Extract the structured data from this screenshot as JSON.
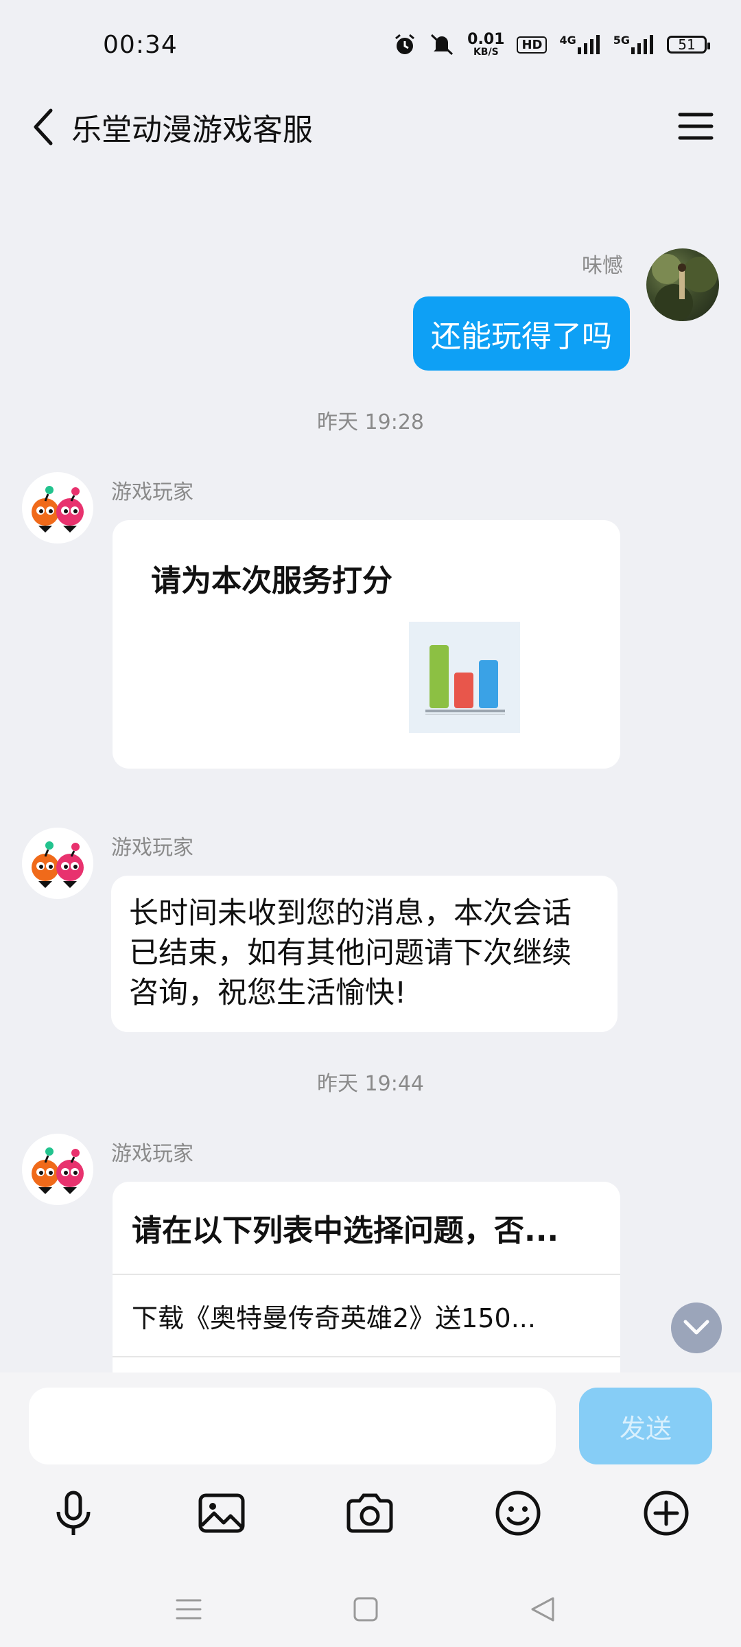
{
  "status": {
    "time": "00:34",
    "net_speed_value": "0.01",
    "net_speed_unit": "KB/S",
    "hd_label": "HD",
    "sig1_label": "4G",
    "sig2_label": "5G",
    "battery": "51"
  },
  "header": {
    "title": "乐堂动漫游戏客服"
  },
  "messages": {
    "my_name": "味憾",
    "my_text": "还能玩得了吗",
    "time1": "昨天 19:28",
    "sender1": "游戏玩家",
    "rating_title": "请为本次服务打分",
    "sender2": "游戏玩家",
    "text2": "长时间未收到您的消息，本次会话已结束，如有其他问题请下次继续咨询，祝您生活愉快!",
    "time2": "昨天 19:44",
    "sender3": "游戏玩家",
    "list_title": "请在以下列表中选择问题，否...",
    "list_items": [
      "下载《奥特曼传奇英雄2》送150..."
    ]
  },
  "input": {
    "placeholder": "",
    "send_label": "发送"
  },
  "colors": {
    "accent": "#0ea0f5",
    "send_disabled": "#86cdf6",
    "background": "#eff0f4"
  }
}
